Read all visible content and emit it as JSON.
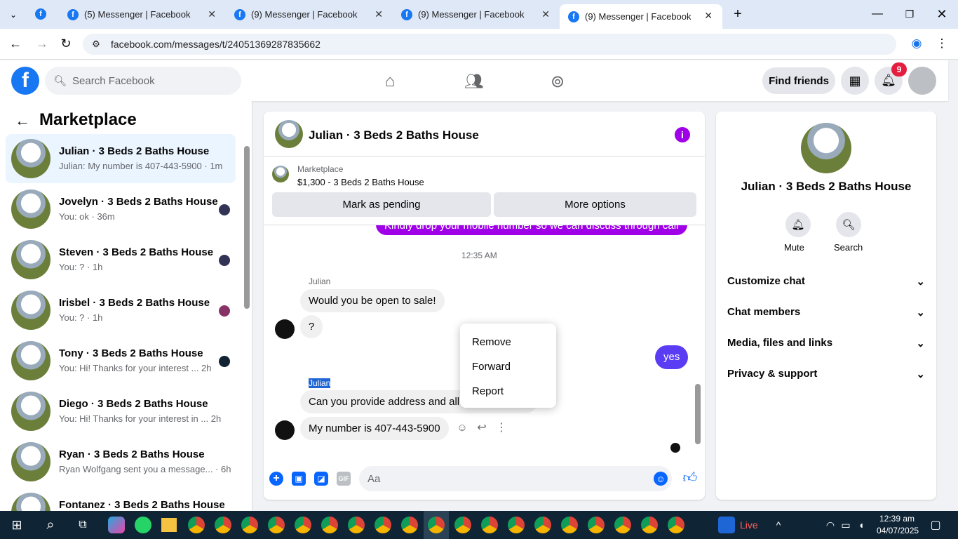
{
  "browser": {
    "tabs": [
      "(5) Messenger | Facebook",
      "(9) Messenger | Facebook",
      "(9) Messenger | Facebook",
      "(9) Messenger | Facebook"
    ],
    "url": "facebook.com/messages/t/24051369287835662"
  },
  "header": {
    "search_placeholder": "Search Facebook",
    "find_friends": "Find friends",
    "notif_count": "9"
  },
  "sidebar": {
    "title": "Marketplace",
    "items": [
      {
        "name": "Julian · 3 Beds 2 Baths House",
        "preview": "Julian: My number is 407-443-5900 · 1m"
      },
      {
        "name": "Jovelyn · 3 Beds 2 Baths House",
        "preview": "You: ok · 36m"
      },
      {
        "name": "Steven · 3 Beds 2 Baths House",
        "preview": "You: ? · 1h"
      },
      {
        "name": "Irisbel · 3 Beds 2 Baths House",
        "preview": "You: ? · 1h"
      },
      {
        "name": "Tony · 3 Beds 2 Baths House",
        "preview": "You: Hi! Thanks for your interest ...  2h"
      },
      {
        "name": "Diego · 3 Beds 2 Baths House",
        "preview": "You: Hi! Thanks for your interest in ...  2h"
      },
      {
        "name": "Ryan · 3 Beds 2 Baths House",
        "preview": "Ryan Wolfgang sent you a message... · 6h"
      },
      {
        "name": "Fontanez · 3 Beds 2 Baths House",
        "preview": ""
      }
    ]
  },
  "chat": {
    "title": "Julian · 3 Beds 2 Baths House",
    "listing_label": "Marketplace",
    "listing": "$1,300 - 3 Beds 2 Baths House",
    "mark_pending": "Mark as pending",
    "more_options": "More options",
    "prev_msg": "Kindly drop your mobile number so we can discuss through call",
    "time": "12:35 AM",
    "sender1": "Julian",
    "m1": "Would you be open to sale!",
    "m2": "?",
    "mine": "yes",
    "sender2": "Julian",
    "m3": "Can you provide address and all p",
    "m4": "My number is 407-443-5900",
    "composer_placeholder": "Aa"
  },
  "menu": {
    "remove": "Remove",
    "forward": "Forward",
    "report": "Report"
  },
  "info": {
    "name": "Julian · 3 Beds 2 Baths House",
    "mute": "Mute",
    "search": "Search",
    "sections": [
      "Customize chat",
      "Chat members",
      "Media, files and links",
      "Privacy & support"
    ]
  },
  "taskbar": {
    "live": "Live",
    "time": "12:39 am",
    "date": "04/07/2025"
  }
}
